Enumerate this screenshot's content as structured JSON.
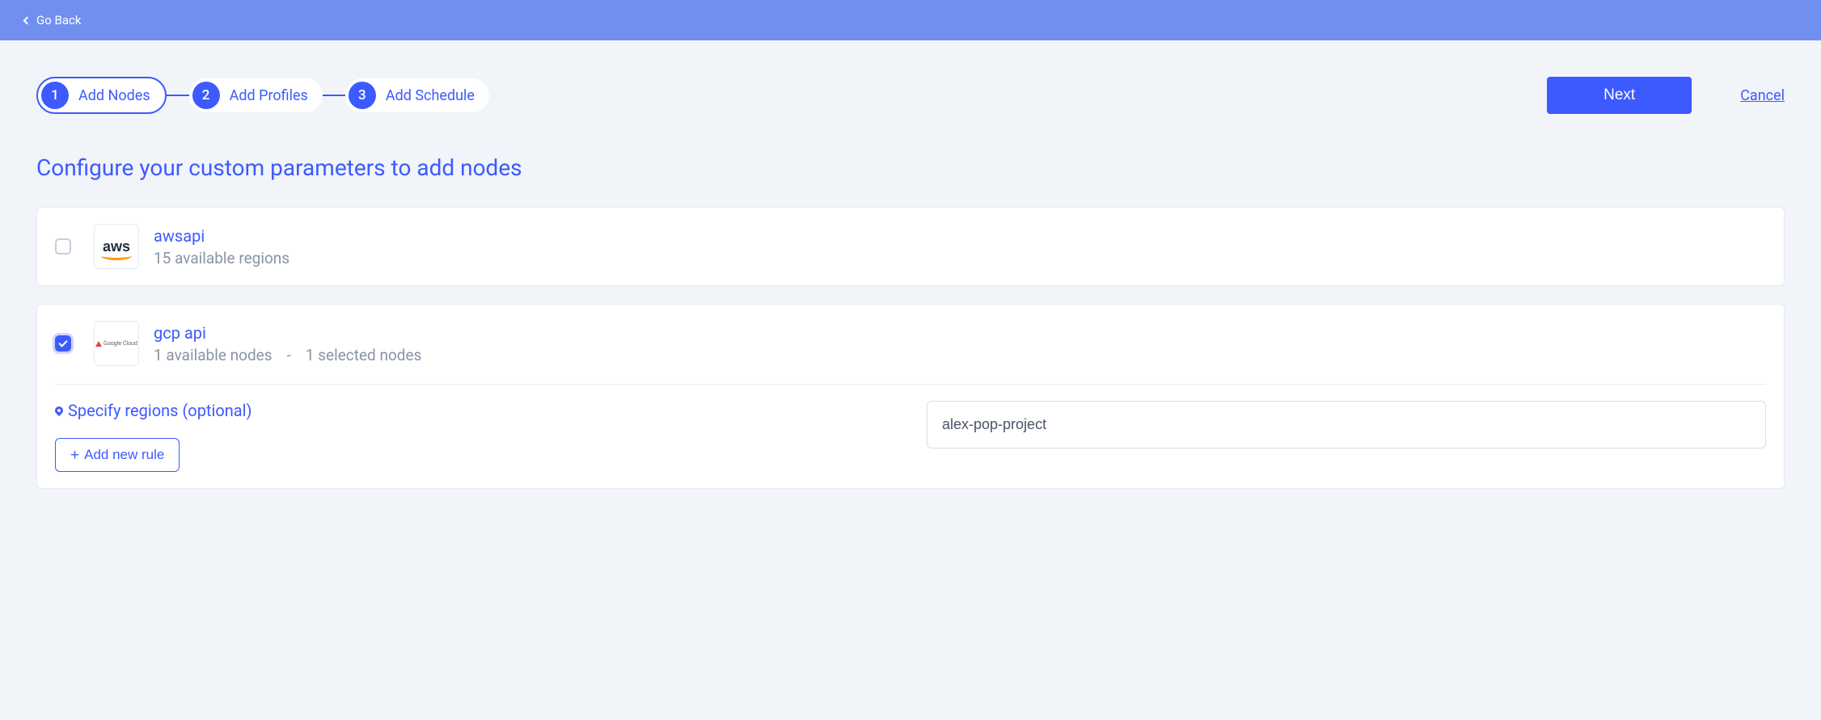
{
  "topbar": {
    "go_back_label": "Go Back"
  },
  "stepper": {
    "steps": [
      {
        "num": "1",
        "label": "Add Nodes",
        "active": true
      },
      {
        "num": "2",
        "label": "Add Profiles",
        "active": false
      },
      {
        "num": "3",
        "label": "Add Schedule",
        "active": false
      }
    ]
  },
  "actions": {
    "next_label": "Next",
    "cancel_label": "Cancel"
  },
  "page_title": "Configure your custom parameters to add nodes",
  "providers": {
    "aws": {
      "name": "awsapi",
      "subtitle": "15 available regions",
      "checked": false
    },
    "gcp": {
      "name": "gcp api",
      "available": "1 available nodes",
      "separator": "-",
      "selected": "1 selected nodes",
      "checked": true
    }
  },
  "regions_section": {
    "title": "Specify regions (optional)",
    "add_rule_label": "Add new rule",
    "input_value": "alex-pop-project"
  }
}
